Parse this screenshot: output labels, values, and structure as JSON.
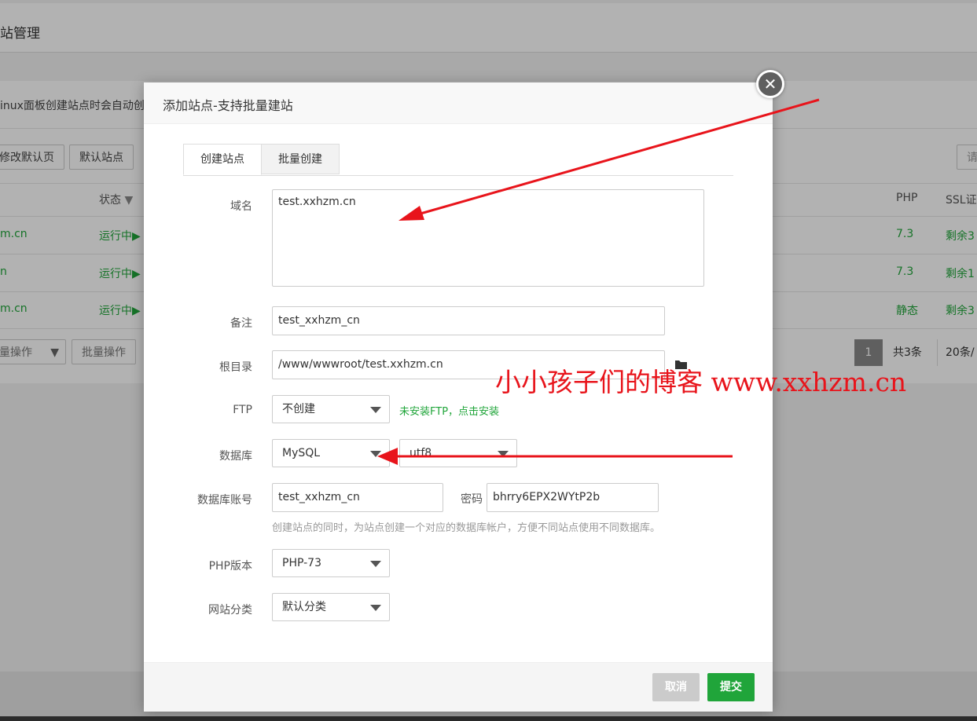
{
  "background": {
    "page_title": "站管理",
    "notice": "inux面板创建站点时会自动创",
    "toolbar": {
      "modify_default_page": "修改默认页",
      "default_site": "默认站点",
      "search_partial": "请"
    },
    "table": {
      "headers": {
        "status": "状态",
        "php": "PHP",
        "ssl": "SSL证"
      },
      "rows": [
        {
          "name": "m.cn",
          "status": "运行中▶",
          "php": "7.3",
          "ssl": "剩余3"
        },
        {
          "name": "n",
          "status": "运行中▶",
          "php": "7.3",
          "ssl": "剩余1"
        },
        {
          "name": "m.cn",
          "status": "运行中▶",
          "php": "静态",
          "ssl": "剩余3"
        }
      ]
    },
    "bulk": {
      "bulk_select": "量操作",
      "bulk_button": "批量操作"
    },
    "pagination": {
      "current_page": "1",
      "total": "共3条",
      "per_page": "20条/"
    }
  },
  "modal": {
    "title": "添加站点-支持批量建站",
    "tabs": [
      {
        "label": "创建站点",
        "active": true
      },
      {
        "label": "批量创建",
        "active": false
      }
    ],
    "form": {
      "domain_label": "域名",
      "domain_value": "test.xxhzm.cn",
      "remark_label": "备注",
      "remark_value": "test_xxhzm_cn",
      "root_label": "根目录",
      "root_value": "/www/wwwroot/test.xxhzm.cn",
      "ftp_label": "FTP",
      "ftp_value": "不创建",
      "ftp_hint": "未安装FTP，点击安装",
      "db_label": "数据库",
      "db_value": "MySQL",
      "db_charset": "utf8",
      "db_user_label": "数据库账号",
      "db_user_value": "test_xxhzm_cn",
      "password_label": "密码",
      "password_value": "bhrry6EPX2WYtP2b",
      "db_hint": "创建站点的同时，为站点创建一个对应的数据库帐户，方便不同站点使用不同数据库。",
      "php_label": "PHP版本",
      "php_value": "PHP-73",
      "category_label": "网站分类",
      "category_value": "默认分类"
    },
    "footer": {
      "cancel": "取消",
      "submit": "提交"
    }
  },
  "watermark": "小小孩子们的博客 www.xxhzm.cn",
  "colors": {
    "accent_green": "#20a53a",
    "annotation_red": "#e8141b"
  }
}
